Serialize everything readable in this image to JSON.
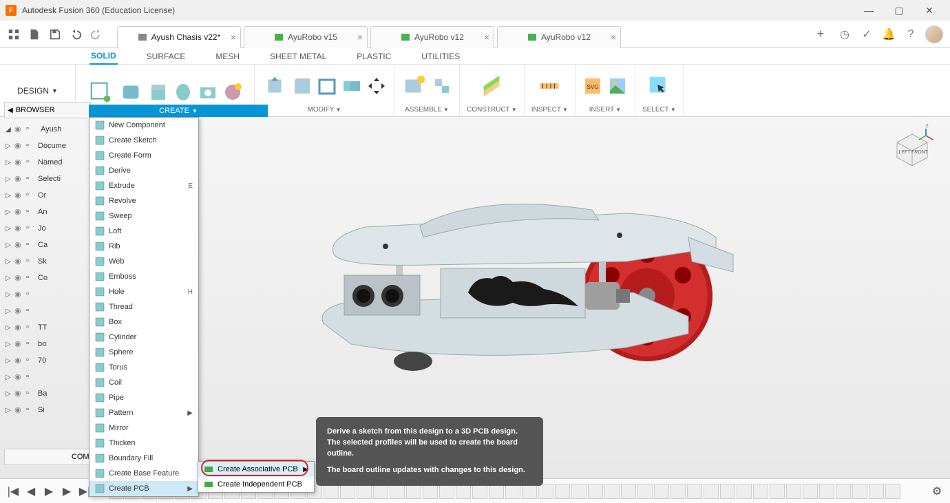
{
  "app": {
    "title": "Autodesk Fusion 360 (Education License)"
  },
  "window_controls": {
    "min": "—",
    "max": "▢",
    "close": "✕"
  },
  "document_tabs": [
    {
      "label": "Ayush Chasis v22*",
      "active": true,
      "icon_color": "#888"
    },
    {
      "label": "AyuRobo v15",
      "active": false,
      "icon_color": "#4caf50"
    },
    {
      "label": "AyuRobo v12",
      "active": false,
      "icon_color": "#4caf50"
    },
    {
      "label": "AyuRobo v12",
      "active": false,
      "icon_color": "#4caf50"
    }
  ],
  "workspace_button": "DESIGN",
  "ribbon_tabs": [
    {
      "label": "SOLID",
      "active": true
    },
    {
      "label": "SURFACE",
      "active": false
    },
    {
      "label": "MESH",
      "active": false
    },
    {
      "label": "SHEET METAL",
      "active": false
    },
    {
      "label": "PLASTIC",
      "active": false
    },
    {
      "label": "UTILITIES",
      "active": false
    }
  ],
  "ribbon_groups": {
    "create": "CREATE",
    "modify": "MODIFY",
    "assemble": "ASSEMBLE",
    "construct": "CONSTRUCT",
    "inspect": "INSPECT",
    "insert": "INSERT",
    "select": "SELECT"
  },
  "browser": {
    "title": "BROWSER",
    "root": "Ayush",
    "items": [
      "Docume",
      "Named",
      "Selecti",
      "Or",
      "An",
      "Jo",
      "Ca",
      "Sk",
      "Co",
      "",
      "",
      "TT",
      "bo",
      "70",
      "",
      "Ba",
      "Si"
    ]
  },
  "comments": {
    "title": "COMMENTS"
  },
  "create_menu": {
    "header": "CREATE",
    "items": [
      {
        "label": "New Component",
        "icon": "new-component"
      },
      {
        "label": "Create Sketch",
        "icon": "sketch"
      },
      {
        "label": "Create Form",
        "icon": "form"
      },
      {
        "label": "Derive",
        "icon": "derive"
      },
      {
        "label": "Extrude",
        "icon": "extrude",
        "shortcut": "E"
      },
      {
        "label": "Revolve",
        "icon": "revolve"
      },
      {
        "label": "Sweep",
        "icon": "sweep"
      },
      {
        "label": "Loft",
        "icon": "loft"
      },
      {
        "label": "Rib",
        "icon": "rib"
      },
      {
        "label": "Web",
        "icon": "web"
      },
      {
        "label": "Emboss",
        "icon": "emboss"
      },
      {
        "label": "Hole",
        "icon": "hole",
        "shortcut": "H"
      },
      {
        "label": "Thread",
        "icon": "thread"
      },
      {
        "label": "Box",
        "icon": "box"
      },
      {
        "label": "Cylinder",
        "icon": "cylinder"
      },
      {
        "label": "Sphere",
        "icon": "sphere"
      },
      {
        "label": "Torus",
        "icon": "torus"
      },
      {
        "label": "Coil",
        "icon": "coil"
      },
      {
        "label": "Pipe",
        "icon": "pipe"
      },
      {
        "label": "Pattern",
        "icon": "",
        "submenu": true
      },
      {
        "label": "Mirror",
        "icon": "mirror"
      },
      {
        "label": "Thicken",
        "icon": "thicken"
      },
      {
        "label": "Boundary Fill",
        "icon": "boundary"
      },
      {
        "label": "Create Base Feature",
        "icon": "base"
      },
      {
        "label": "Create PCB",
        "icon": "",
        "submenu": true,
        "highlighted": true
      }
    ]
  },
  "pcb_submenu": {
    "items": [
      {
        "label": "Create Associative PCB",
        "highlighted": true
      },
      {
        "label": "Create Independent PCB",
        "highlighted": false
      }
    ]
  },
  "tooltip": {
    "line1": "Derive a sketch from this design to a 3D PCB design. The selected profiles will be used to create the board outline.",
    "line2": "The board outline updates with changes to this design."
  },
  "viewcube": {
    "front": "FRONT",
    "left": "LEFT"
  },
  "timeline_feature_count": 48
}
